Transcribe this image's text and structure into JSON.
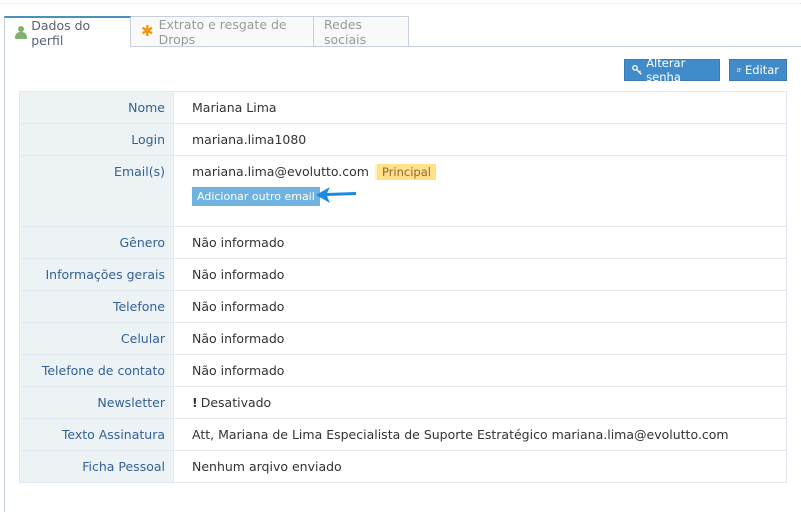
{
  "tabs": [
    {
      "label": "Dados do perfil",
      "icon": "user-icon",
      "active": true
    },
    {
      "label": "Extrato e resgate de Drops",
      "icon": "asterisk-icon",
      "active": false
    },
    {
      "label": "Redes sociais",
      "icon": "",
      "active": false
    }
  ],
  "actions": {
    "change_password": "Alterar senha",
    "edit": "Editar"
  },
  "profile": {
    "nome": {
      "label": "Nome",
      "value": "Mariana Lima"
    },
    "login": {
      "label": "Login",
      "value": "mariana.lima1080"
    },
    "email": {
      "label": "Email(s)",
      "value": "mariana.lima@evolutto.com",
      "badge": "Principal",
      "add_button": "Adicionar outro email"
    },
    "genero": {
      "label": "Gênero",
      "value": "Não informado"
    },
    "info": {
      "label": "Informações gerais",
      "value": "Não informado"
    },
    "telefone": {
      "label": "Telefone",
      "value": "Não informado"
    },
    "celular": {
      "label": "Celular",
      "value": "Não informado"
    },
    "tel_contato": {
      "label": "Telefone de contato",
      "value": "Não informado"
    },
    "newsletter": {
      "label": "Newsletter",
      "mark": "!",
      "value": "Desativado"
    },
    "assinatura": {
      "label": "Texto Assinatura",
      "value": "Att, Mariana de Lima Especialista de Suporte Estratégico mariana.lima@evolutto.com"
    },
    "ficha": {
      "label": "Ficha Pessoal",
      "value": "Nenhum arqivo enviado"
    }
  },
  "colors": {
    "primary": "#428bca",
    "label_text": "#336199",
    "label_bg": "#edf3f4",
    "badge_bg": "#fee188",
    "arrow": "#1e88e5"
  }
}
